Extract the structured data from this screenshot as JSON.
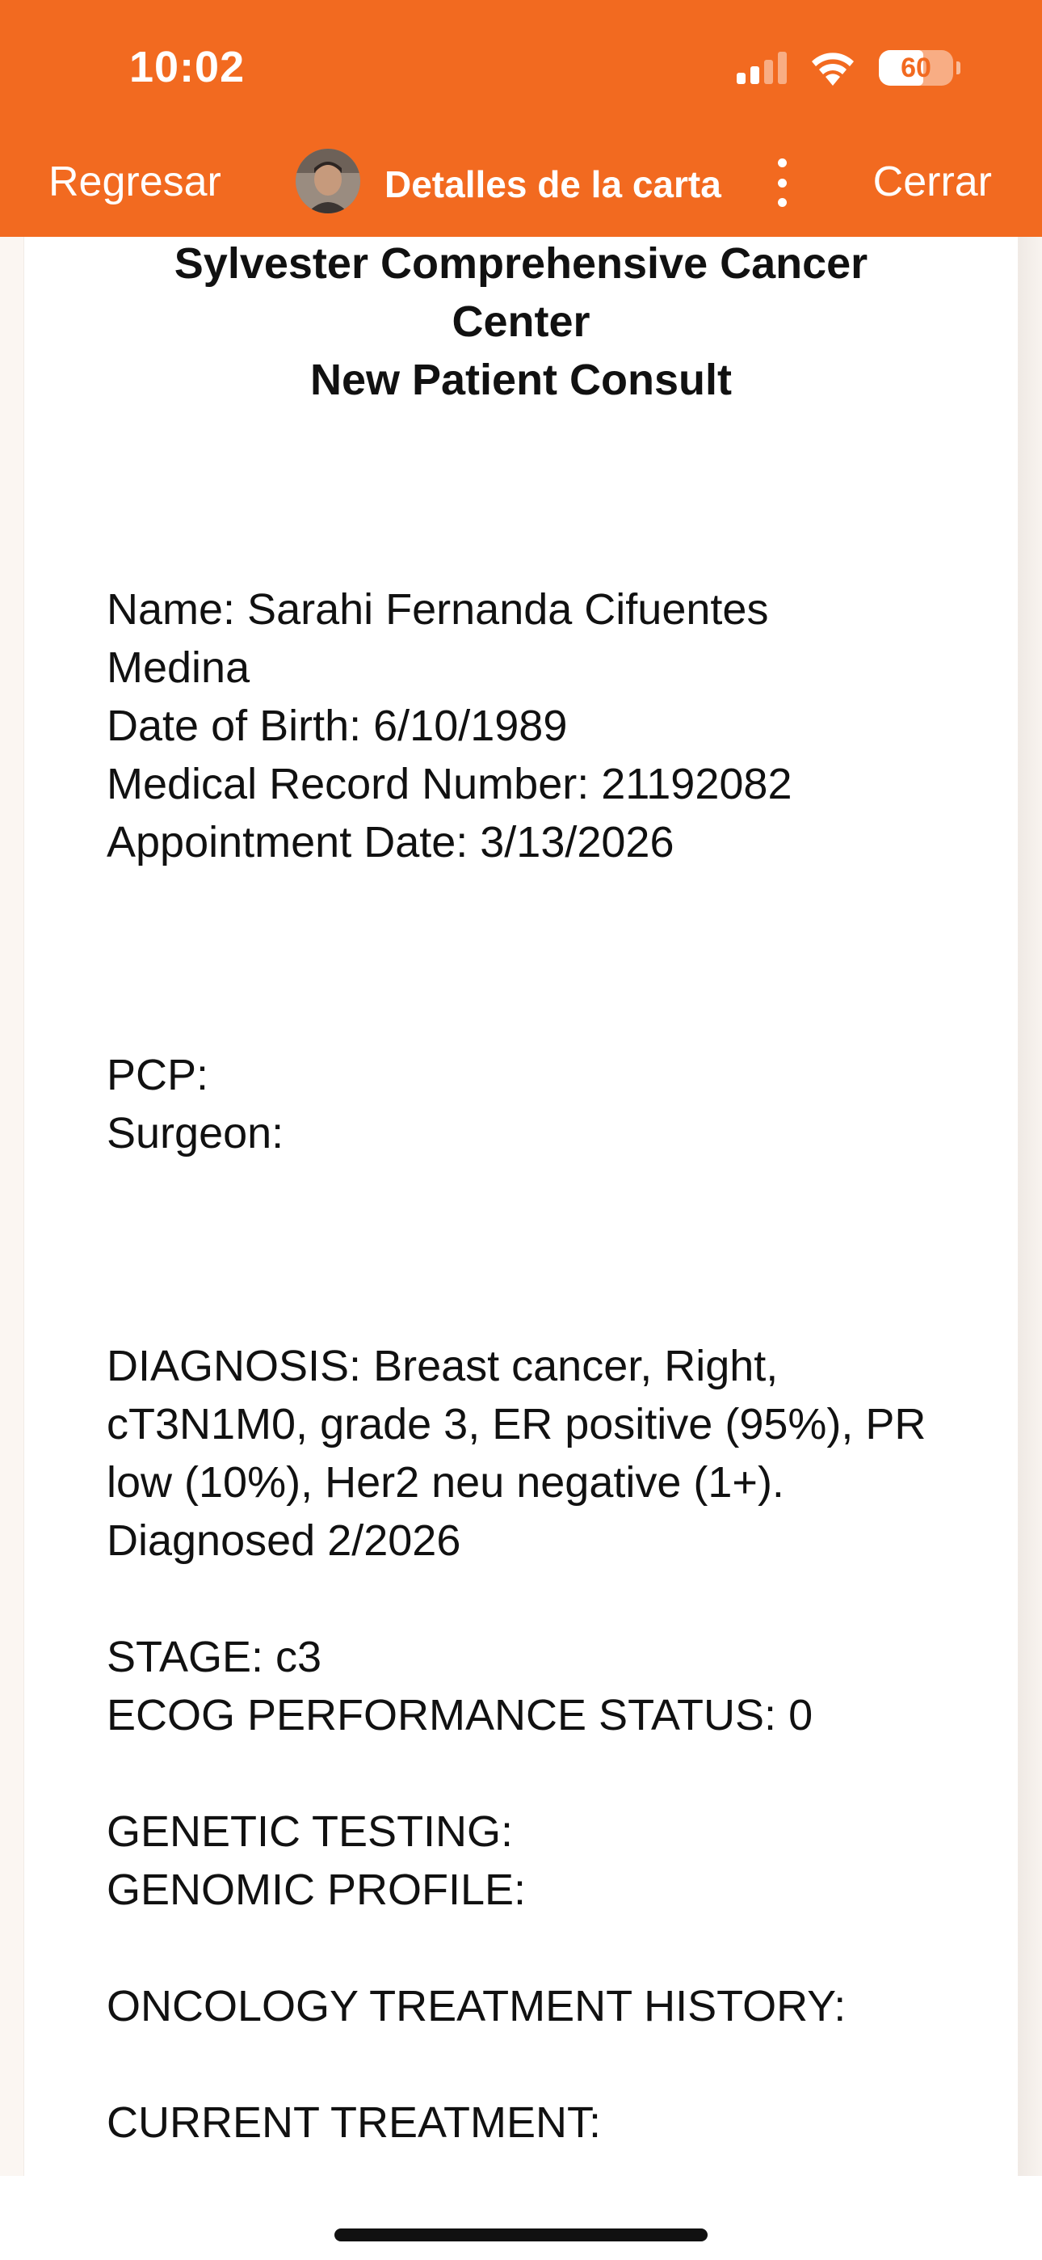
{
  "status_bar": {
    "time": "10:02",
    "battery_level": "60",
    "signal_icon": "cellular-signal-icon",
    "wifi_icon": "wifi-icon"
  },
  "nav": {
    "back_label": "Regresar",
    "title": "Detalles de la carta",
    "close_label": "Cerrar",
    "more_icon": "more-vertical-icon",
    "accent_color": "#f26a20"
  },
  "document": {
    "title_lines": [
      "Sylvester Comprehensive Cancer",
      "Center",
      "New Patient Consult"
    ],
    "patient": {
      "name_line1": "Name: Sarahi Fernanda Cifuentes",
      "name_line2": "Medina",
      "dob": "Date of Birth: 6/10/1989",
      "mrn": "Medical Record Number: 21192082",
      "appointment": "Appointment Date: 3/13/2026"
    },
    "care_team": {
      "pcp": "PCP:",
      "surgeon": "Surgeon:"
    },
    "diagnosis_lines": [
      "DIAGNOSIS: Breast cancer, Right,",
      "cT3N1M0, grade 3, ER positive (95%), PR",
      "low (10%), Her2 neu negative (1+).",
      "Diagnosed 2/2026"
    ],
    "stage": "STAGE: c3",
    "ecog": "ECOG PERFORMANCE STATUS: 0",
    "genetic_testing": "GENETIC TESTING:",
    "genomic_profile": "GENOMIC PROFILE:",
    "oncology_history": "ONCOLOGY TREATMENT HISTORY:",
    "current_treatment": "CURRENT TREATMENT:"
  }
}
